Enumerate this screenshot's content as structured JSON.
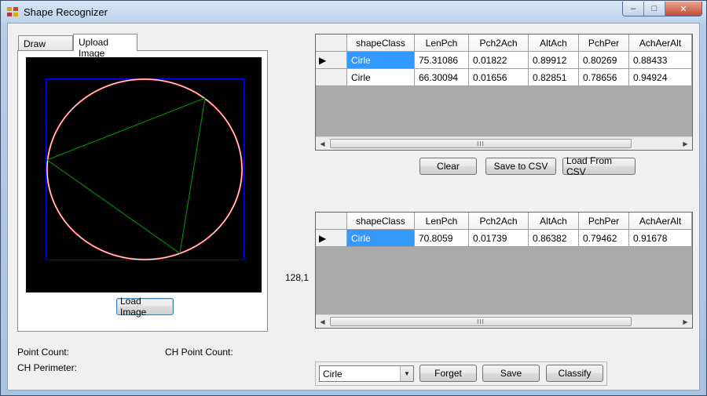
{
  "window": {
    "title": "Shape Recognizer",
    "caption_buttons": {
      "minimize": "–",
      "maximize": "□",
      "close": "✕"
    }
  },
  "tabs": [
    {
      "label": "Draw Shape",
      "active": false
    },
    {
      "label": "Upload Image",
      "active": true
    }
  ],
  "left_panel": {
    "load_image_label": "Load Image",
    "point_count_label": "Point Count:",
    "ch_point_count_label": "CH Point Count:",
    "ch_perimeter_label": "CH Perimeter:"
  },
  "coordinate_readout": "128,1",
  "columns": [
    "shapeClass",
    "LenPch",
    "Pch2Ach",
    "AltAch",
    "PchPer",
    "AchAerAlt"
  ],
  "training_grid": {
    "rows": [
      [
        "Cirle",
        "75.31086",
        "0.01822",
        "0.89912",
        "0.80269",
        "0.88433"
      ],
      [
        "Cirle",
        "66.30094",
        "0.01656",
        "0.82851",
        "0.78656",
        "0.94924"
      ]
    ],
    "selected_row": 0
  },
  "current_grid": {
    "rows": [
      [
        "Cirle",
        "70.8059",
        "0.01739",
        "0.86382",
        "0.79462",
        "0.91678"
      ]
    ],
    "selected_row": 0
  },
  "buttons": {
    "clear": "Clear",
    "save_csv": "Save to CSV",
    "load_csv": "Load From CSV",
    "forget": "Forget",
    "save": "Save",
    "classify": "Classify"
  },
  "class_select": {
    "selected": "Cirle"
  },
  "scrollbar_grip": "III",
  "colors": {
    "selection": "#3399ff",
    "canvas_bg": "#000000",
    "circle": "#ffffff",
    "circle_edge": "#ff3333",
    "triangle": "#00a000",
    "bounding_box": "#0000ff",
    "grid_empty": "#ababab"
  }
}
